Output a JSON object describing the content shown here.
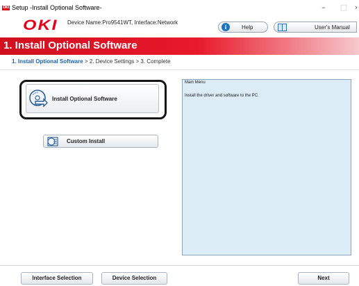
{
  "window": {
    "app_badge": "OKI",
    "title": "Setup -Install Optional Software-",
    "minimize_glyph": "–",
    "maximize_glyph": "□",
    "close_glyph": "›"
  },
  "header": {
    "logo_text": "OKI",
    "device_info": "Device Name:Pro9541WT, Interface:Network",
    "help_label": "Help",
    "help_icon": "info-icon",
    "manual_label": "User's Manual",
    "manual_icon": "book-icon"
  },
  "banner": {
    "title": "1. Install Optional Software",
    "color": "#e2001a"
  },
  "breadcrumb": {
    "active": "1. Install Optional Software",
    "rest": " > 2. Device Settings > 3. Complete"
  },
  "options": {
    "install": {
      "label": "Install Optional Software",
      "icon": "cd-install-icon"
    },
    "custom": {
      "label": "Custom Install",
      "icon": "custom-list-icon"
    }
  },
  "info_panel": {
    "title": "Main Menu",
    "description": "Install the driver and software to the PC."
  },
  "footer": {
    "interface_selection": "Interface Selection",
    "device_selection": "Device Selection",
    "next": "Next"
  }
}
